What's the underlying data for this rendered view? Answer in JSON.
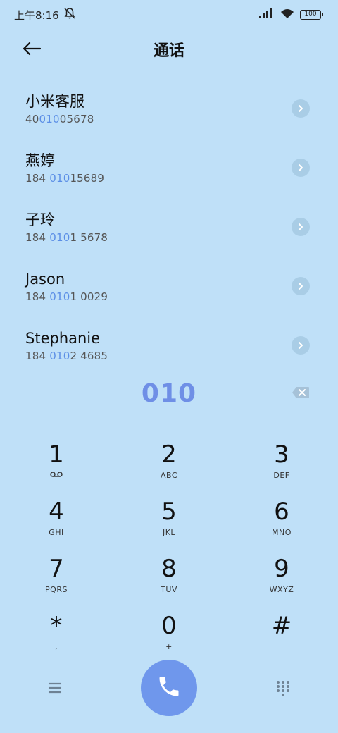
{
  "status_bar": {
    "time": "上午8:16",
    "battery": "100"
  },
  "header": {
    "title": "通话"
  },
  "contacts": [
    {
      "name": "小米客服",
      "number_pre": "40",
      "number_hl": "010",
      "number_post": "05678"
    },
    {
      "name": "燕婷",
      "number_pre": "184 ",
      "number_hl": "010",
      "number_post": "15689"
    },
    {
      "name": "子玲",
      "number_pre": "184 ",
      "number_hl": "010",
      "number_post": "1 5678"
    },
    {
      "name": "Jason",
      "number_pre": "184 ",
      "number_hl": "010",
      "number_post": "1 0029"
    },
    {
      "name": "Stephanie",
      "number_pre": "184 ",
      "number_hl": "010",
      "number_post": "2 4685"
    }
  ],
  "dial_input": "010",
  "keypad": [
    {
      "digit": "1",
      "sub": ""
    },
    {
      "digit": "2",
      "sub": "ABC"
    },
    {
      "digit": "3",
      "sub": "DEF"
    },
    {
      "digit": "4",
      "sub": "GHI"
    },
    {
      "digit": "5",
      "sub": "JKL"
    },
    {
      "digit": "6",
      "sub": "MNO"
    },
    {
      "digit": "7",
      "sub": "PQRS"
    },
    {
      "digit": "8",
      "sub": "TUV"
    },
    {
      "digit": "9",
      "sub": "WXYZ"
    },
    {
      "digit": "*",
      "sub": ","
    },
    {
      "digit": "0",
      "sub": "+"
    },
    {
      "digit": "#",
      "sub": ""
    }
  ],
  "icons": {
    "back": "back-arrow-icon",
    "mute": "bell-off-icon",
    "signal": "signal-icon",
    "wifi": "wifi-icon",
    "voicemail": "voicemail-icon",
    "chevron": "chevron-right-icon",
    "backspace": "backspace-icon",
    "menu": "menu-icon",
    "phone": "phone-icon",
    "dialpad": "dialpad-icon"
  },
  "colors": {
    "background": "#bfe0f8",
    "accent": "#6f97ec",
    "highlight": "#5b8ee6"
  }
}
